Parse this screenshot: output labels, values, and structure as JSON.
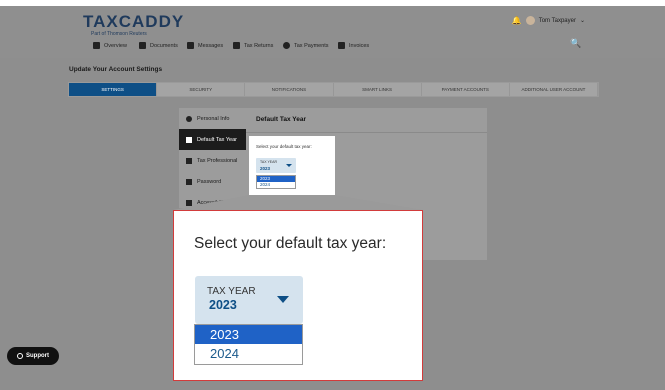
{
  "header": {
    "logo": "TAXCADDY",
    "logo_sub": "Part of Thomson Reuters",
    "user_name": "Tom Taxpayer",
    "nav": [
      {
        "label": "Overview",
        "icon": "home-icon"
      },
      {
        "label": "Documents",
        "icon": "documents-icon"
      },
      {
        "label": "Messages",
        "icon": "messages-icon"
      },
      {
        "label": "Tax Returns",
        "icon": "tax-returns-icon"
      },
      {
        "label": "Tax Payments",
        "icon": "dollar-icon"
      },
      {
        "label": "Invoices",
        "icon": "invoice-icon"
      }
    ]
  },
  "page": {
    "title": "Update Your Account Settings",
    "tabs": [
      "SETTINGS",
      "SECURITY",
      "NOTIFICATIONS",
      "SMART LINKS",
      "PAYMENT ACCOUNTS",
      "ADDITIONAL USER ACCOUNT"
    ],
    "active_tab": "SETTINGS"
  },
  "sidebar": {
    "items": [
      {
        "label": "Personal Info",
        "icon": "person-icon"
      },
      {
        "label": "Default Tax Year",
        "icon": "calendar-icon"
      },
      {
        "label": "Tax Professional",
        "icon": "briefcase-icon"
      },
      {
        "label": "Password",
        "icon": "lock-icon"
      },
      {
        "label": "Accessibility",
        "icon": "accessibility-icon"
      }
    ],
    "active": "Default Tax Year"
  },
  "content": {
    "title": "Default Tax Year",
    "prompt": "Select your default tax year:",
    "select_label": "TAX YEAR",
    "selected_value": "2023",
    "options": [
      "2023",
      "2024"
    ]
  },
  "support": {
    "label": "Support"
  },
  "colors": {
    "accent": "#0e4f86",
    "highlight": "#1f62c6",
    "callout_border": "#d23b3b"
  }
}
